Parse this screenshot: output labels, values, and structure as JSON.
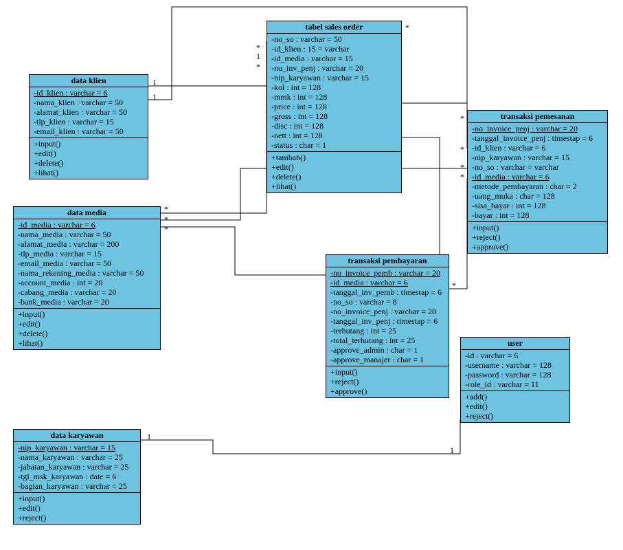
{
  "classes": {
    "klien": {
      "title": "data klien",
      "attrs": [
        "-id_klien : varchar = 6",
        "-nama_klien : varchar = 50",
        "-alamat_klien : varchar = 50",
        "-tlp_klien : varchar = 15",
        "-email_klien : varchar = 50"
      ],
      "ops": [
        "+input()",
        "+edit()",
        "+delete()",
        "+lihat()"
      ],
      "underline_idx": [
        0
      ]
    },
    "sales": {
      "title": "tabel sales order",
      "attrs": [
        "-no_so : varchar = 50",
        "-id_klien : 15 = varchar",
        "-id_media : varchar = 15",
        "-no_inv_penj : varchar = 20",
        "-nip_karyawan : varchar = 15",
        "-kol : int = 128",
        "-mmk : int = 128",
        "-price : int = 128",
        "-gross : int = 128",
        "-disc : int = 128",
        "-nett : int = 128",
        "-status : char = 1"
      ],
      "ops": [
        "+tambah()",
        "+edit()",
        "+delete()",
        "+lihat()"
      ],
      "underline_idx": []
    },
    "pemesanan": {
      "title": "transaksi pemesanan",
      "attrs": [
        "-no_invoice_penj : varchar = 20",
        "-tanggal_invoice_penj : timestap = 6",
        "-id_klien : varchar = 6",
        "-nip_karyawan : varchar = 15",
        "-no_so : varchar = varchar",
        "-id_media : varchar = 6",
        "-metode_pembayaran : char = 2",
        "-uang_muka : char = 128",
        "-sisa_bayar : int = 128",
        "-bayar : int = 128"
      ],
      "ops": [
        "+input()",
        "+reject()",
        "+approve()"
      ],
      "underline_idx": [
        0,
        5
      ]
    },
    "media": {
      "title": "data media",
      "attrs": [
        "-id_media : varchar = 6",
        "-nama_media : varchar = 50",
        "-alamat_media : varchar = 200",
        "-tlp_media : varchar = 15",
        "-email_media : varchar = 50",
        "-nama_rekening_media : varchar = 50",
        "-account_media : int = 20",
        "-cabang_media : varchar = 20",
        "-bank_media : varchar = 20"
      ],
      "ops": [
        "+input()",
        "+edit()",
        "+delete()",
        "+lihat()"
      ],
      "underline_idx": [
        0
      ]
    },
    "pembayaran": {
      "title": "transaksi pembayaran",
      "attrs": [
        "-no_invoice_pemb : varchar = 20",
        "-id_media : varchar = 6",
        "-tanggal_inv_pemb : timestap = 6",
        "-no_so : varchar = 8",
        "-no_invoice_penj : varchar = 20",
        "-tanggal_inv_penj : timestap = 6",
        "-terhutang : int = 25",
        "-total_terhutang : int = 25",
        "-approve_admin : char = 1",
        "-approve_manajer : char = 1"
      ],
      "ops": [
        "+input()",
        "+reject()",
        "+approve()"
      ],
      "underline_idx": [
        0,
        1
      ]
    },
    "user": {
      "title": "user",
      "attrs": [
        "-id : varchar = 6",
        "-username : varchar = 128",
        "-password : varchar = 128",
        "-role_id : varchar = 11"
      ],
      "ops": [
        "+add()",
        "+edit()",
        "+reject()"
      ],
      "underline_idx": []
    },
    "karyawan": {
      "title": "data karyawan",
      "attrs": [
        "-nip_karyawan : varchar = 15",
        "-nama_karyawan : varchar = 25",
        "-jabatan_karyawan : varchar = 25",
        "-tgl_msk_karyawan : date = 6",
        "-bagian_karyawan : varchar = 25"
      ],
      "ops": [
        "+input()",
        "+edit()",
        "+reject()"
      ],
      "underline_idx": [
        0
      ]
    }
  },
  "labels": {
    "l1a": "1",
    "l1b": "1",
    "l2a": "*",
    "l2b": "*",
    "l3a": "1",
    "l3b": "*",
    "l4a": "*",
    "l4b": "*",
    "l5a": "*",
    "l5b": "*",
    "l6a": "1",
    "l6b": "1",
    "l7a": "*",
    "l7b": "*",
    "l8a": "*",
    "l8b": "*",
    "l9a": "1",
    "l9b": "1"
  }
}
